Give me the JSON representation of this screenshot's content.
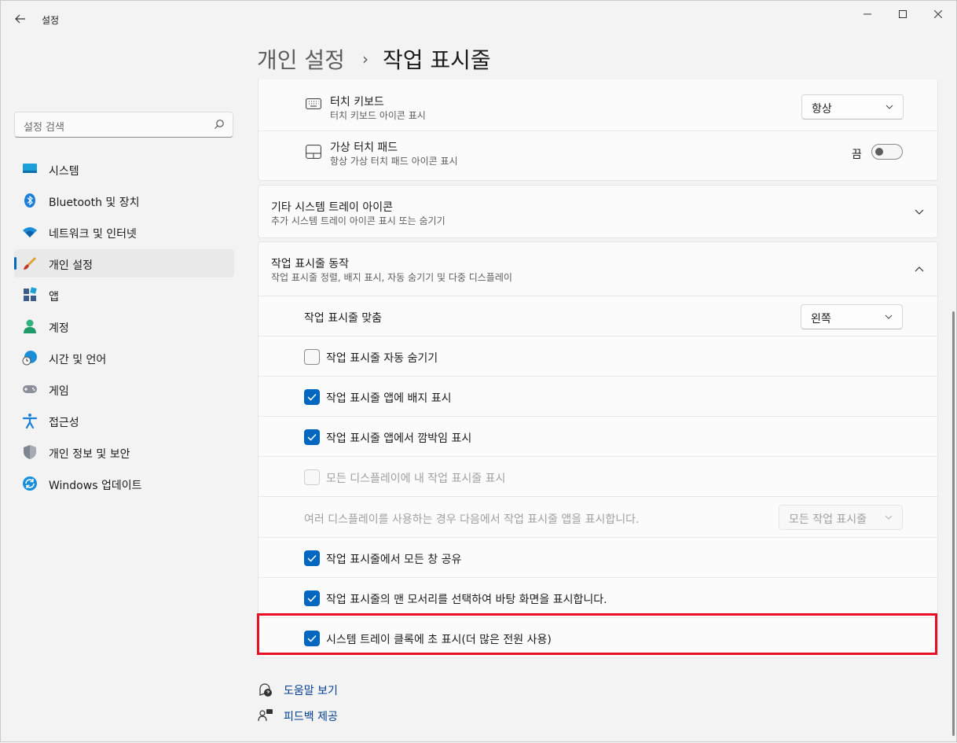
{
  "app": {
    "title": "설정"
  },
  "window_controls": {
    "minimize": "—",
    "maximize": "☐",
    "close": "✕"
  },
  "search": {
    "placeholder": "설정 검색"
  },
  "sidebar": {
    "items": [
      {
        "label": "시스템",
        "icon": "system-display-icon"
      },
      {
        "label": "Bluetooth 및 장치",
        "icon": "bluetooth-icon"
      },
      {
        "label": "네트워크 및 인터넷",
        "icon": "wifi-icon"
      },
      {
        "label": "개인 설정",
        "icon": "paintbrush-icon",
        "active": true
      },
      {
        "label": "앱",
        "icon": "apps-icon"
      },
      {
        "label": "계정",
        "icon": "person-icon"
      },
      {
        "label": "시간 및 언어",
        "icon": "globe-clock-icon"
      },
      {
        "label": "게임",
        "icon": "gamepad-icon"
      },
      {
        "label": "접근성",
        "icon": "accessibility-icon"
      },
      {
        "label": "개인 정보 및 보안",
        "icon": "shield-icon"
      },
      {
        "label": "Windows 업데이트",
        "icon": "update-icon"
      }
    ]
  },
  "header": {
    "parent": "개인 설정",
    "separator": "›",
    "current": "작업 표시줄"
  },
  "pen_card": {
    "touch_keyboard": {
      "title": "터치 키보드",
      "subtitle": "터치 키보드 아이콘 표시",
      "value": "항상"
    },
    "virtual_touchpad": {
      "title": "가상 터치 패드",
      "subtitle": "항상 가상 터치 패드 아이콘 표시",
      "state_label": "끔",
      "on": false
    }
  },
  "other_tray": {
    "title": "기타 시스템 트레이 아이콘",
    "subtitle": "추가 시스템 트레이 아이콘 표시 또는 숨기기"
  },
  "behaviors": {
    "title": "작업 표시줄 동작",
    "subtitle": "작업 표시줄 정렬, 배지 표시, 자동 숨기기 및 다중 디스플레이",
    "alignment": {
      "label": "작업 표시줄 맞춤",
      "value": "왼쪽"
    },
    "auto_hide": {
      "label": "작업 표시줄 자동 숨기기",
      "checked": false
    },
    "badges": {
      "label": "작업 표시줄 앱에 배지 표시",
      "checked": true
    },
    "flashing": {
      "label": "작업 표시줄 앱에서 깜박임 표시",
      "checked": true
    },
    "all_displays": {
      "label": "모든 디스플레이에 내 작업 표시줄 표시",
      "checked": false,
      "disabled": true
    },
    "multi_display": {
      "label": "여러 디스플레이를 사용하는 경우 다음에서 작업 표시줄 앱을 표시합니다.",
      "value": "모든 작업 표시줄",
      "disabled": true
    },
    "share_window": {
      "label": "작업 표시줄에서 모든 창 공유",
      "checked": true
    },
    "far_corner": {
      "label": "작업 표시줄의 맨 모서리를 선택하여 바탕 화면을 표시합니다.",
      "checked": true
    },
    "seconds_clock": {
      "label": "시스템 트레이 클록에 초 표시(더 많은 전원 사용)",
      "checked": true
    }
  },
  "footer": {
    "help": "도움말 보기",
    "feedback": "피드백 제공"
  },
  "colors": {
    "accent": "#0067c0",
    "highlight": "#e81123"
  }
}
